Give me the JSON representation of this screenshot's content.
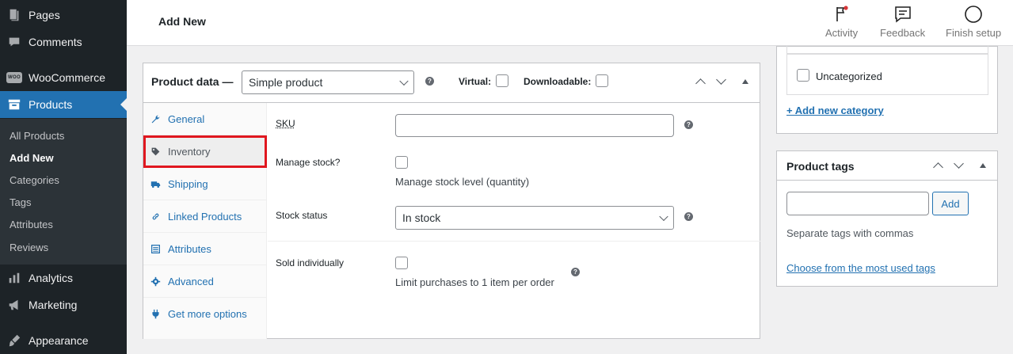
{
  "sidebar": {
    "items": {
      "pages": "Pages",
      "comments": "Comments",
      "woocommerce": "WooCommerce",
      "products": "Products",
      "analytics": "Analytics",
      "marketing": "Marketing",
      "appearance": "Appearance"
    },
    "woo_badge": "WOO",
    "submenu": [
      "All Products",
      "Add New",
      "Categories",
      "Tags",
      "Attributes",
      "Reviews"
    ]
  },
  "header": {
    "title": "Add New",
    "actions": [
      "Activity",
      "Feedback",
      "Finish setup"
    ]
  },
  "product_data": {
    "title": "Product data —",
    "type_select": "Simple product",
    "help": "?",
    "virtual_label": "Virtual:",
    "downloadable_label": "Downloadable:",
    "tabs": [
      "General",
      "Inventory",
      "Shipping",
      "Linked Products",
      "Attributes",
      "Advanced",
      "Get more options"
    ],
    "active_tab": "Inventory",
    "fields": {
      "sku_label": "SKU",
      "sku_value": "",
      "manage_stock_label": "Manage stock?",
      "manage_stock_desc": "Manage stock level (quantity)",
      "stock_status_label": "Stock status",
      "stock_status_value": "In stock",
      "sold_individually_label": "Sold individually",
      "sold_individually_desc": "Limit purchases to 1 item per order"
    }
  },
  "categories_box": {
    "uncategorized": "Uncategorized",
    "add_link": "+ Add new category"
  },
  "tags_box": {
    "title": "Product tags",
    "input_value": "",
    "add_button": "Add",
    "hint": "Separate tags with commas",
    "choose_link": "Choose from the most used tags"
  },
  "colors": {
    "sidebar_bg": "#1d2327",
    "accent": "#2271b1",
    "highlight_border": "#e0171f",
    "activity_dot": "#d63638"
  }
}
